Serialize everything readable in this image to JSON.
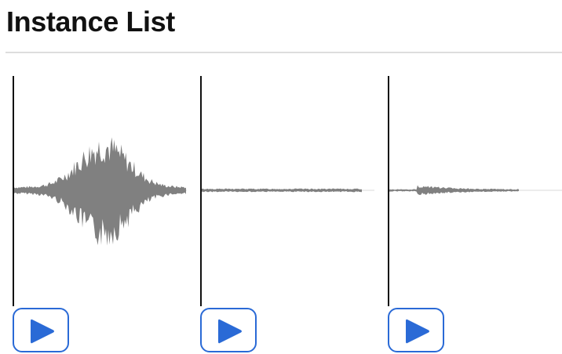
{
  "page": {
    "title": "Instance List"
  },
  "colors": {
    "accent": "#2a6ad6",
    "waveform": "#808080",
    "baseline": "#d8d8d8",
    "divider": "#dddddd",
    "text": "#111111"
  },
  "icons": {
    "play": "play-icon"
  },
  "instances": [
    {
      "index": 1,
      "waveform_profile": "loud-burst"
    },
    {
      "index": 2,
      "waveform_profile": "quiet-flat"
    },
    {
      "index": 3,
      "waveform_profile": "short-quiet-burst"
    }
  ]
}
